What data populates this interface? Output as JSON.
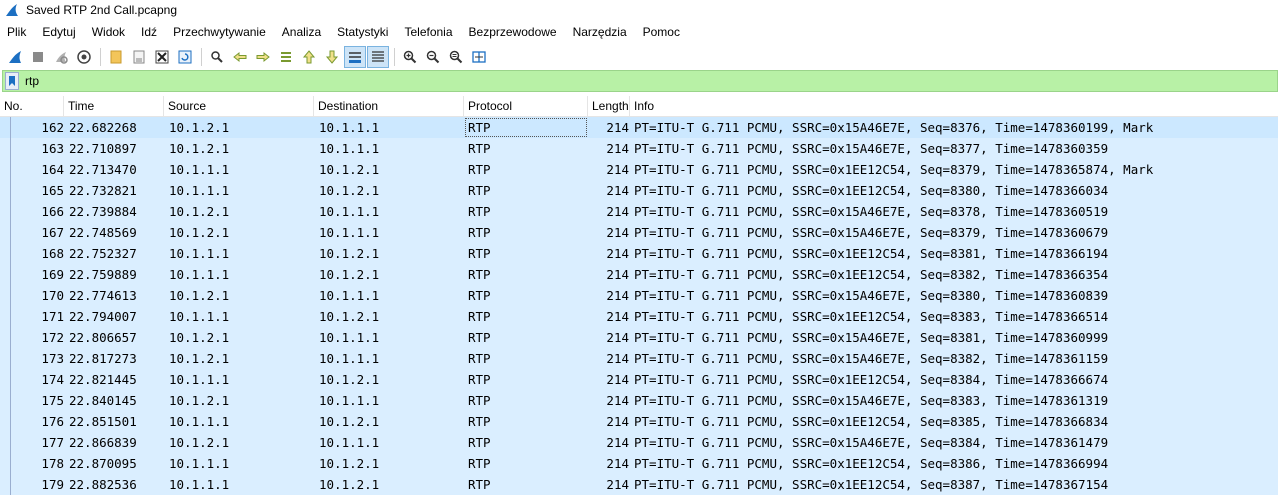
{
  "window": {
    "title": "Saved RTP 2nd Call.pcapng"
  },
  "menu": [
    "Plik",
    "Edytuj",
    "Widok",
    "Idź",
    "Przechwytywanie",
    "Analiza",
    "Statystyki",
    "Telefonia",
    "Bezprzewodowe",
    "Narzędzia",
    "Pomoc"
  ],
  "filter": {
    "value": "rtp"
  },
  "columns": {
    "no": "No.",
    "time": "Time",
    "source": "Source",
    "destination": "Destination",
    "protocol": "Protocol",
    "length": "Length",
    "info": "Info"
  },
  "packets": [
    {
      "no": "162",
      "time": "22.682268",
      "src": "10.1.2.1",
      "dst": "10.1.1.1",
      "proto": "RTP",
      "len": "214",
      "info": "PT=ITU-T G.711 PCMU, SSRC=0x15A46E7E, Seq=8376, Time=1478360199, Mark"
    },
    {
      "no": "163",
      "time": "22.710897",
      "src": "10.1.2.1",
      "dst": "10.1.1.1",
      "proto": "RTP",
      "len": "214",
      "info": "PT=ITU-T G.711 PCMU, SSRC=0x15A46E7E, Seq=8377, Time=1478360359"
    },
    {
      "no": "164",
      "time": "22.713470",
      "src": "10.1.1.1",
      "dst": "10.1.2.1",
      "proto": "RTP",
      "len": "214",
      "info": "PT=ITU-T G.711 PCMU, SSRC=0x1EE12C54, Seq=8379, Time=1478365874, Mark"
    },
    {
      "no": "165",
      "time": "22.732821",
      "src": "10.1.1.1",
      "dst": "10.1.2.1",
      "proto": "RTP",
      "len": "214",
      "info": "PT=ITU-T G.711 PCMU, SSRC=0x1EE12C54, Seq=8380, Time=1478366034"
    },
    {
      "no": "166",
      "time": "22.739884",
      "src": "10.1.2.1",
      "dst": "10.1.1.1",
      "proto": "RTP",
      "len": "214",
      "info": "PT=ITU-T G.711 PCMU, SSRC=0x15A46E7E, Seq=8378, Time=1478360519"
    },
    {
      "no": "167",
      "time": "22.748569",
      "src": "10.1.2.1",
      "dst": "10.1.1.1",
      "proto": "RTP",
      "len": "214",
      "info": "PT=ITU-T G.711 PCMU, SSRC=0x15A46E7E, Seq=8379, Time=1478360679"
    },
    {
      "no": "168",
      "time": "22.752327",
      "src": "10.1.1.1",
      "dst": "10.1.2.1",
      "proto": "RTP",
      "len": "214",
      "info": "PT=ITU-T G.711 PCMU, SSRC=0x1EE12C54, Seq=8381, Time=1478366194"
    },
    {
      "no": "169",
      "time": "22.759889",
      "src": "10.1.1.1",
      "dst": "10.1.2.1",
      "proto": "RTP",
      "len": "214",
      "info": "PT=ITU-T G.711 PCMU, SSRC=0x1EE12C54, Seq=8382, Time=1478366354"
    },
    {
      "no": "170",
      "time": "22.774613",
      "src": "10.1.2.1",
      "dst": "10.1.1.1",
      "proto": "RTP",
      "len": "214",
      "info": "PT=ITU-T G.711 PCMU, SSRC=0x15A46E7E, Seq=8380, Time=1478360839"
    },
    {
      "no": "171",
      "time": "22.794007",
      "src": "10.1.1.1",
      "dst": "10.1.2.1",
      "proto": "RTP",
      "len": "214",
      "info": "PT=ITU-T G.711 PCMU, SSRC=0x1EE12C54, Seq=8383, Time=1478366514"
    },
    {
      "no": "172",
      "time": "22.806657",
      "src": "10.1.2.1",
      "dst": "10.1.1.1",
      "proto": "RTP",
      "len": "214",
      "info": "PT=ITU-T G.711 PCMU, SSRC=0x15A46E7E, Seq=8381, Time=1478360999"
    },
    {
      "no": "173",
      "time": "22.817273",
      "src": "10.1.2.1",
      "dst": "10.1.1.1",
      "proto": "RTP",
      "len": "214",
      "info": "PT=ITU-T G.711 PCMU, SSRC=0x15A46E7E, Seq=8382, Time=1478361159"
    },
    {
      "no": "174",
      "time": "22.821445",
      "src": "10.1.1.1",
      "dst": "10.1.2.1",
      "proto": "RTP",
      "len": "214",
      "info": "PT=ITU-T G.711 PCMU, SSRC=0x1EE12C54, Seq=8384, Time=1478366674"
    },
    {
      "no": "175",
      "time": "22.840145",
      "src": "10.1.2.1",
      "dst": "10.1.1.1",
      "proto": "RTP",
      "len": "214",
      "info": "PT=ITU-T G.711 PCMU, SSRC=0x15A46E7E, Seq=8383, Time=1478361319"
    },
    {
      "no": "176",
      "time": "22.851501",
      "src": "10.1.1.1",
      "dst": "10.1.2.1",
      "proto": "RTP",
      "len": "214",
      "info": "PT=ITU-T G.711 PCMU, SSRC=0x1EE12C54, Seq=8385, Time=1478366834"
    },
    {
      "no": "177",
      "time": "22.866839",
      "src": "10.1.2.1",
      "dst": "10.1.1.1",
      "proto": "RTP",
      "len": "214",
      "info": "PT=ITU-T G.711 PCMU, SSRC=0x15A46E7E, Seq=8384, Time=1478361479"
    },
    {
      "no": "178",
      "time": "22.870095",
      "src": "10.1.1.1",
      "dst": "10.1.2.1",
      "proto": "RTP",
      "len": "214",
      "info": "PT=ITU-T G.711 PCMU, SSRC=0x1EE12C54, Seq=8386, Time=1478366994"
    },
    {
      "no": "179",
      "time": "22.882536",
      "src": "10.1.1.1",
      "dst": "10.1.2.1",
      "proto": "RTP",
      "len": "214",
      "info": "PT=ITU-T G.711 PCMU, SSRC=0x1EE12C54, Seq=8387, Time=1478367154"
    }
  ],
  "colors": {
    "row_bg": "#daeeff",
    "selected_bg": "#cce8ff",
    "filter_bg": "#b8f1a6"
  },
  "toolbar_icons": [
    "shark-fin-start-icon",
    "stop-icon",
    "restart-icon",
    "options-icon",
    "open-file-icon",
    "save-file-icon",
    "close-file-icon",
    "reload-icon",
    "find-icon",
    "go-back-icon",
    "go-forward-icon",
    "go-to-packet-icon",
    "first-packet-icon",
    "last-packet-icon",
    "autoscroll-icon",
    "colorize-icon",
    "zoom-in-icon",
    "zoom-out-icon",
    "zoom-normal-icon",
    "resize-columns-icon"
  ]
}
